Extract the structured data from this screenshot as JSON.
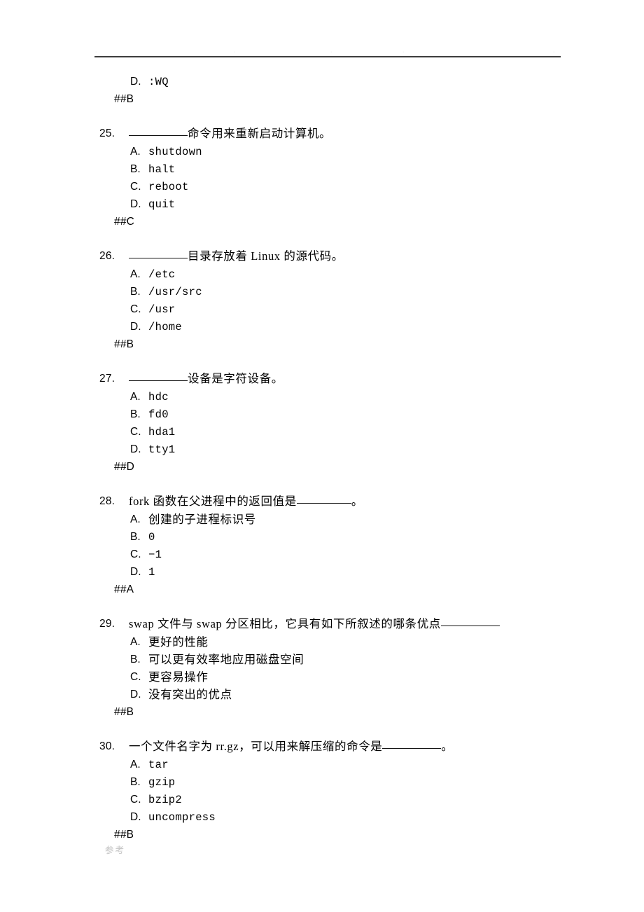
{
  "page": {
    "header_artifacts": [
      "·",
      "·",
      "·",
      "·",
      "·"
    ],
    "footer_note": "参考"
  },
  "carryover": {
    "option": {
      "letter": "D.",
      "text": ":WQ"
    },
    "answer": "##B"
  },
  "questions": [
    {
      "number": "25.",
      "stem_before": "",
      "stem_after": "命令用来重新启动计算机。",
      "blank": true,
      "blank_width": "blank-8",
      "options": [
        {
          "letter": "A.",
          "text": "shutdown",
          "style": "mono"
        },
        {
          "letter": "B.",
          "text": "halt",
          "style": "mono"
        },
        {
          "letter": "C.",
          "text": "reboot",
          "style": "mono"
        },
        {
          "letter": "D.",
          "text": "quit",
          "style": "mono"
        }
      ],
      "answer": "##C"
    },
    {
      "number": "26.",
      "stem_before": "",
      "stem_after": "目录存放着 Linux 的源代码。",
      "blank": true,
      "blank_width": "blank-8",
      "options": [
        {
          "letter": "A.",
          "text": "/etc",
          "style": "mono"
        },
        {
          "letter": "B.",
          "text": "/usr/src",
          "style": "mono"
        },
        {
          "letter": "C.",
          "text": "/usr",
          "style": "mono"
        },
        {
          "letter": "D.",
          "text": "/home",
          "style": "mono"
        }
      ],
      "answer": "##B"
    },
    {
      "number": "27.",
      "stem_before": "",
      "stem_after": "设备是字符设备。",
      "blank": true,
      "blank_width": "blank-8",
      "options": [
        {
          "letter": "A.",
          "text": "hdc",
          "style": "mono"
        },
        {
          "letter": "B.",
          "text": "fd0",
          "style": "mono"
        },
        {
          "letter": "C.",
          "text": "hda1",
          "style": "mono"
        },
        {
          "letter": "D.",
          "text": "tty1",
          "style": "mono"
        }
      ],
      "answer": "##D"
    },
    {
      "number": "28.",
      "stem_before": "fork 函数在父进程中的返回值是",
      "stem_after": "。",
      "blank": true,
      "blank_width": "blank-7",
      "options": [
        {
          "letter": "A.",
          "text": "创建的子进程标识号",
          "style": "cjk"
        },
        {
          "letter": "B.",
          "text": "0",
          "style": "mono"
        },
        {
          "letter": "C.",
          "text": "−1",
          "style": "mono"
        },
        {
          "letter": "D.",
          "text": "1",
          "style": "mono"
        }
      ],
      "answer": "##A"
    },
    {
      "number": "29.",
      "stem_before": "swap 文件与 swap 分区相比，它具有如下所叙述的哪条优点",
      "stem_after": "",
      "blank": true,
      "blank_width": "blank-8",
      "options": [
        {
          "letter": "A.",
          "text": "更好的性能",
          "style": "cjk"
        },
        {
          "letter": "B.",
          "text": "可以更有效率地应用磁盘空间",
          "style": "cjk"
        },
        {
          "letter": "C.",
          "text": "更容易操作",
          "style": "cjk"
        },
        {
          "letter": "D.",
          "text": "没有突出的优点",
          "style": "cjk"
        }
      ],
      "answer": "##B"
    },
    {
      "number": "30.",
      "stem_before": "一个文件名字为 rr.gz，可以用来解压缩的命令是",
      "stem_after": "。",
      "blank": true,
      "blank_width": "blank-8",
      "options": [
        {
          "letter": "A.",
          "text": "tar",
          "style": "mono"
        },
        {
          "letter": "B.",
          "text": "gzip",
          "style": "mono"
        },
        {
          "letter": "C.",
          "text": "bzip2",
          "style": "mono"
        },
        {
          "letter": "D.",
          "text": "uncompress",
          "style": "mono"
        }
      ],
      "answer": "##B"
    }
  ]
}
